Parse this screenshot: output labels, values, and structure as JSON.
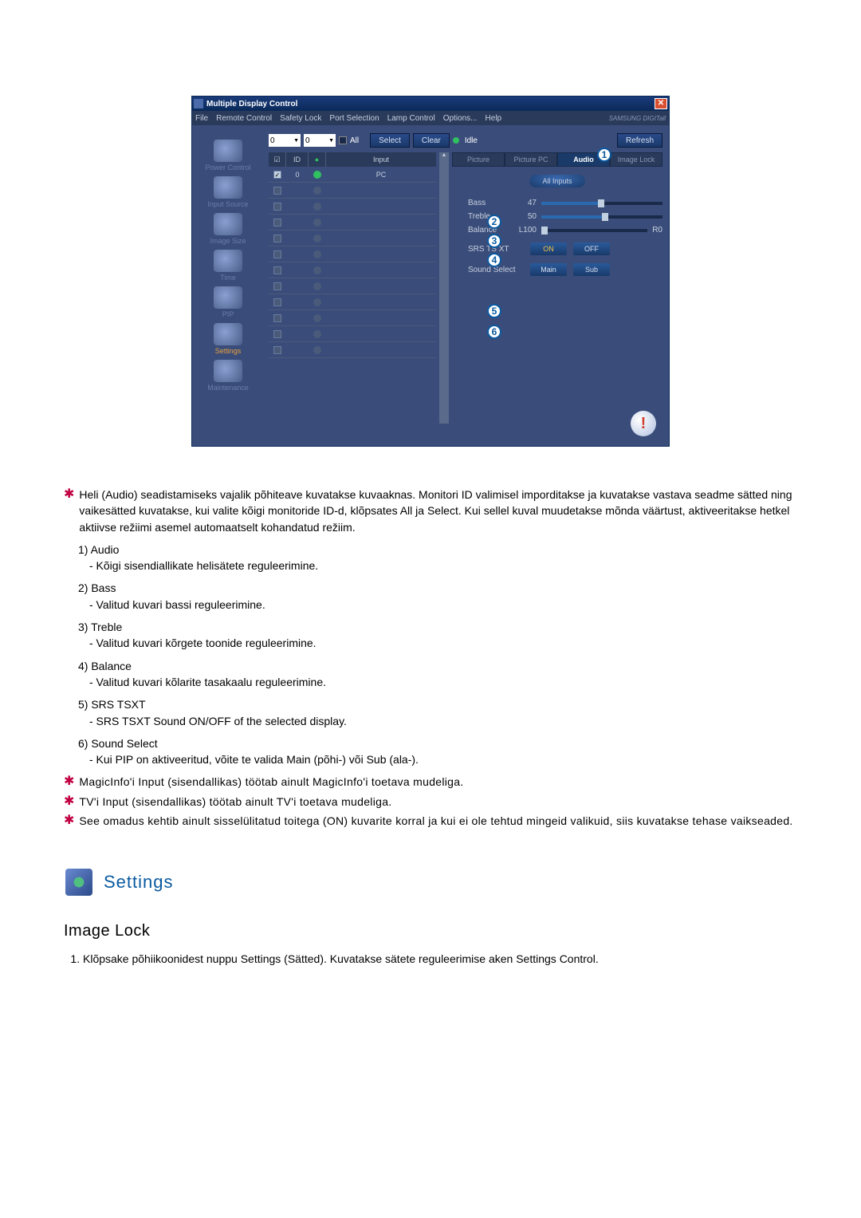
{
  "app": {
    "title": "Multiple Display Control",
    "menu": [
      "File",
      "Remote Control",
      "Safety Lock",
      "Port Selection",
      "Lamp Control",
      "Options...",
      "Help"
    ],
    "brand": "SAMSUNG DIGITall"
  },
  "sidebar": {
    "items": [
      {
        "label": "Power Control"
      },
      {
        "label": "Input Source"
      },
      {
        "label": "Image Size"
      },
      {
        "label": "Time"
      },
      {
        "label": "PIP"
      },
      {
        "label": "Settings",
        "active": true
      },
      {
        "label": "Maintenance"
      }
    ]
  },
  "toprow": {
    "dd1": "0",
    "dd2": "0",
    "all_label": "All",
    "select": "Select",
    "clear": "Clear",
    "idle": "Idle",
    "refresh": "Refresh"
  },
  "table": {
    "headers": {
      "c1": "☑",
      "c2": "ID",
      "c3": "●",
      "c4": "Input"
    },
    "rows": [
      {
        "chk": true,
        "id": "0",
        "dot": "green",
        "input": "PC"
      },
      {
        "chk": false
      },
      {
        "chk": false
      },
      {
        "chk": false
      },
      {
        "chk": false
      },
      {
        "chk": false
      },
      {
        "chk": false
      },
      {
        "chk": false
      },
      {
        "chk": false
      },
      {
        "chk": false
      },
      {
        "chk": false
      },
      {
        "chk": false
      }
    ]
  },
  "tabs": [
    "Picture",
    "Picture PC",
    "Audio",
    "Image Lock"
  ],
  "active_tab_index": 2,
  "pill": "All Inputs",
  "audio": {
    "bass": {
      "label": "Bass",
      "value": 47
    },
    "treble": {
      "label": "Treble",
      "value": 50
    },
    "balance": {
      "label": "Balance",
      "left": "L100",
      "right": "R0",
      "pos": 0
    }
  },
  "srs": {
    "label": "SRS TS XT",
    "on": "ON",
    "off": "OFF"
  },
  "soundsel": {
    "label": "Sound Select",
    "main": "Main",
    "sub": "Sub"
  },
  "callouts": [
    "1",
    "2",
    "3",
    "4",
    "5",
    "6"
  ],
  "doc": {
    "intro": "Heli (Audio) seadistamiseks vajalik põhiteave kuvatakse kuvaaknas. Monitori ID valimisel imporditakse ja kuvatakse vastava seadme sätted ning vaikesätted kuvatakse, kui valite kõigi monitoride ID-d, klõpsates All ja Select. Kui sellel kuval muudetakse mõnda väärtust, aktiveeritakse hetkel aktiivse režiimi asemel automaatselt kohandatud režiim.",
    "items": [
      {
        "n": "1)",
        "t": "Audio",
        "d": "- Kõigi sisendiallikate helisätete reguleerimine."
      },
      {
        "n": "2)",
        "t": "Bass",
        "d": "- Valitud kuvari bassi reguleerimine."
      },
      {
        "n": "3)",
        "t": "Treble",
        "d": "- Valitud kuvari kõrgete toonide reguleerimine."
      },
      {
        "n": "4)",
        "t": "Balance",
        "d": "- Valitud kuvari kõlarite tasakaalu reguleerimine."
      },
      {
        "n": "5)",
        "t": "SRS TSXT",
        "d": "- SRS TSXT Sound ON/OFF of the selected display."
      },
      {
        "n": "6)",
        "t": "Sound Select",
        "d": "- Kui PIP on aktiveeritud, võite te valida Main (põhi-) või Sub (ala-)."
      }
    ],
    "notes": [
      "MagicInfo'i Input (sisendallikas) töötab ainult MagicInfo'i toetava mudeliga.",
      "TV'i Input (sisendallikas) töötab ainult TV'i toetava mudeliga.",
      "See omadus kehtib ainult sisselülitatud toitega (ON) kuvarite korral ja kui ei ole tehtud mingeid valikuid, siis kuvatakse tehase vaikseaded."
    ],
    "settings_heading": "Settings",
    "subheading": "Image Lock",
    "final_step": "Klõpsake põhiikoonidest nuppu Settings (Sätted). Kuvatakse sätete reguleerimise aken Settings Control."
  }
}
